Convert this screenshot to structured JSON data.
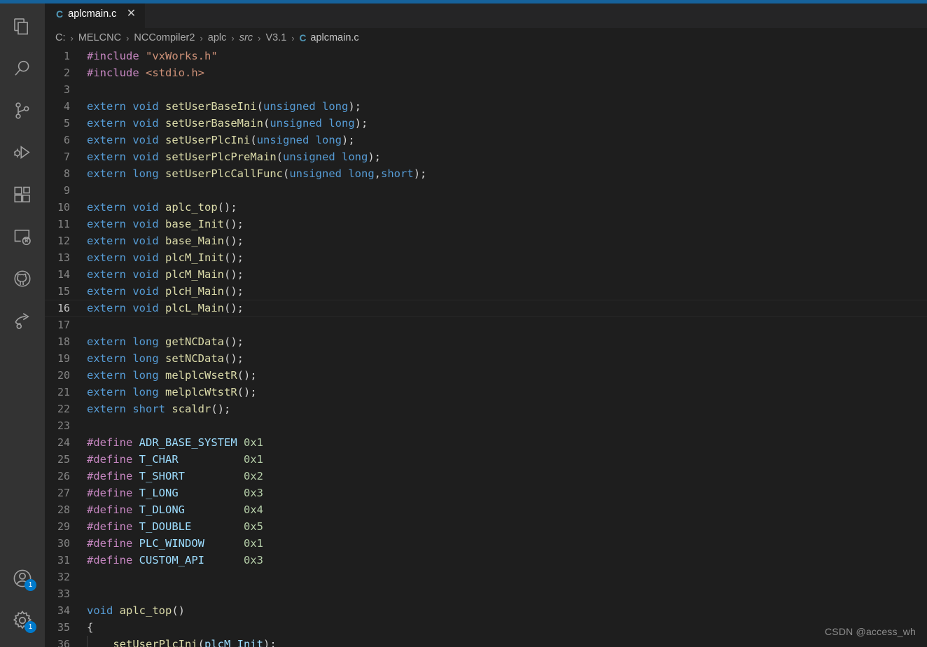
{
  "theme": {
    "accent": "#16629b",
    "activity_bar_bg": "#333333",
    "tab_bar_bg": "#252526",
    "editor_bg": "#1e1e1e",
    "badge_bg": "#007acc"
  },
  "activity_bar": {
    "top_items": [
      {
        "name": "explorer",
        "icon": "files-icon",
        "title": "Explorer"
      },
      {
        "name": "search",
        "icon": "search-icon",
        "title": "Search"
      },
      {
        "name": "source-control",
        "icon": "source-control-icon",
        "title": "Source Control"
      },
      {
        "name": "run-debug",
        "icon": "run-and-debug-icon",
        "title": "Run and Debug"
      },
      {
        "name": "extensions",
        "icon": "extensions-icon",
        "title": "Extensions"
      },
      {
        "name": "remote-explorer",
        "icon": "remote-explorer-icon",
        "title": "Remote Explorer"
      },
      {
        "name": "github",
        "icon": "github-icon",
        "title": "GitHub"
      },
      {
        "name": "live-share",
        "icon": "live-share-icon",
        "title": "Live Share"
      }
    ],
    "bottom_items": [
      {
        "name": "accounts",
        "icon": "account-icon",
        "title": "Accounts",
        "badge": "1"
      },
      {
        "name": "manage",
        "icon": "gear-icon",
        "title": "Manage",
        "badge": "1"
      }
    ]
  },
  "tabs": [
    {
      "label": "aplcmain.c",
      "ext_icon": "C",
      "close_icon": "✕",
      "active": true
    }
  ],
  "breadcrumbs": {
    "separator": "›",
    "items": [
      {
        "label": "C:",
        "italic": false
      },
      {
        "label": "MELCNC",
        "italic": false
      },
      {
        "label": "NCCompiler2",
        "italic": false
      },
      {
        "label": "aplc",
        "italic": false
      },
      {
        "label": "src",
        "italic": true
      },
      {
        "label": "V3.1",
        "italic": false
      }
    ],
    "file_icon": "C",
    "file": "aplcmain.c"
  },
  "editor": {
    "current_line": 16,
    "first_line": 1,
    "lines": [
      {
        "n": 1,
        "tokens": [
          {
            "t": "pre",
            "v": "#include"
          },
          {
            "t": "plain",
            "v": " "
          },
          {
            "t": "str",
            "v": "\"vxWorks.h\""
          }
        ]
      },
      {
        "n": 2,
        "tokens": [
          {
            "t": "pre",
            "v": "#include"
          },
          {
            "t": "plain",
            "v": " "
          },
          {
            "t": "str",
            "v": "<stdio.h>"
          }
        ]
      },
      {
        "n": 3,
        "tokens": []
      },
      {
        "n": 4,
        "tokens": [
          {
            "t": "kw",
            "v": "extern"
          },
          {
            "t": "plain",
            "v": " "
          },
          {
            "t": "kw",
            "v": "void"
          },
          {
            "t": "plain",
            "v": " "
          },
          {
            "t": "fn",
            "v": "setUserBaseIni"
          },
          {
            "t": "punc",
            "v": "("
          },
          {
            "t": "kw",
            "v": "unsigned"
          },
          {
            "t": "plain",
            "v": " "
          },
          {
            "t": "kw",
            "v": "long"
          },
          {
            "t": "punc",
            "v": ");"
          }
        ]
      },
      {
        "n": 5,
        "tokens": [
          {
            "t": "kw",
            "v": "extern"
          },
          {
            "t": "plain",
            "v": " "
          },
          {
            "t": "kw",
            "v": "void"
          },
          {
            "t": "plain",
            "v": " "
          },
          {
            "t": "fn",
            "v": "setUserBaseMain"
          },
          {
            "t": "punc",
            "v": "("
          },
          {
            "t": "kw",
            "v": "unsigned"
          },
          {
            "t": "plain",
            "v": " "
          },
          {
            "t": "kw",
            "v": "long"
          },
          {
            "t": "punc",
            "v": ");"
          }
        ]
      },
      {
        "n": 6,
        "tokens": [
          {
            "t": "kw",
            "v": "extern"
          },
          {
            "t": "plain",
            "v": " "
          },
          {
            "t": "kw",
            "v": "void"
          },
          {
            "t": "plain",
            "v": " "
          },
          {
            "t": "fn",
            "v": "setUserPlcIni"
          },
          {
            "t": "punc",
            "v": "("
          },
          {
            "t": "kw",
            "v": "unsigned"
          },
          {
            "t": "plain",
            "v": " "
          },
          {
            "t": "kw",
            "v": "long"
          },
          {
            "t": "punc",
            "v": ");"
          }
        ]
      },
      {
        "n": 7,
        "tokens": [
          {
            "t": "kw",
            "v": "extern"
          },
          {
            "t": "plain",
            "v": " "
          },
          {
            "t": "kw",
            "v": "void"
          },
          {
            "t": "plain",
            "v": " "
          },
          {
            "t": "fn",
            "v": "setUserPlcPreMain"
          },
          {
            "t": "punc",
            "v": "("
          },
          {
            "t": "kw",
            "v": "unsigned"
          },
          {
            "t": "plain",
            "v": " "
          },
          {
            "t": "kw",
            "v": "long"
          },
          {
            "t": "punc",
            "v": ");"
          }
        ]
      },
      {
        "n": 8,
        "tokens": [
          {
            "t": "kw",
            "v": "extern"
          },
          {
            "t": "plain",
            "v": " "
          },
          {
            "t": "kw",
            "v": "long"
          },
          {
            "t": "plain",
            "v": " "
          },
          {
            "t": "fn",
            "v": "setUserPlcCallFunc"
          },
          {
            "t": "punc",
            "v": "("
          },
          {
            "t": "kw",
            "v": "unsigned"
          },
          {
            "t": "plain",
            "v": " "
          },
          {
            "t": "kw",
            "v": "long"
          },
          {
            "t": "punc",
            "v": ","
          },
          {
            "t": "kw",
            "v": "short"
          },
          {
            "t": "punc",
            "v": ");"
          }
        ]
      },
      {
        "n": 9,
        "tokens": []
      },
      {
        "n": 10,
        "tokens": [
          {
            "t": "kw",
            "v": "extern"
          },
          {
            "t": "plain",
            "v": " "
          },
          {
            "t": "kw",
            "v": "void"
          },
          {
            "t": "plain",
            "v": " "
          },
          {
            "t": "fn",
            "v": "aplc_top"
          },
          {
            "t": "punc",
            "v": "();"
          }
        ]
      },
      {
        "n": 11,
        "tokens": [
          {
            "t": "kw",
            "v": "extern"
          },
          {
            "t": "plain",
            "v": " "
          },
          {
            "t": "kw",
            "v": "void"
          },
          {
            "t": "plain",
            "v": " "
          },
          {
            "t": "fn",
            "v": "base_Init"
          },
          {
            "t": "punc",
            "v": "();"
          }
        ]
      },
      {
        "n": 12,
        "tokens": [
          {
            "t": "kw",
            "v": "extern"
          },
          {
            "t": "plain",
            "v": " "
          },
          {
            "t": "kw",
            "v": "void"
          },
          {
            "t": "plain",
            "v": " "
          },
          {
            "t": "fn",
            "v": "base_Main"
          },
          {
            "t": "punc",
            "v": "();"
          }
        ]
      },
      {
        "n": 13,
        "tokens": [
          {
            "t": "kw",
            "v": "extern"
          },
          {
            "t": "plain",
            "v": " "
          },
          {
            "t": "kw",
            "v": "void"
          },
          {
            "t": "plain",
            "v": " "
          },
          {
            "t": "fn",
            "v": "plcM_Init"
          },
          {
            "t": "punc",
            "v": "();"
          }
        ]
      },
      {
        "n": 14,
        "tokens": [
          {
            "t": "kw",
            "v": "extern"
          },
          {
            "t": "plain",
            "v": " "
          },
          {
            "t": "kw",
            "v": "void"
          },
          {
            "t": "plain",
            "v": " "
          },
          {
            "t": "fn",
            "v": "plcM_Main"
          },
          {
            "t": "punc",
            "v": "();"
          }
        ]
      },
      {
        "n": 15,
        "tokens": [
          {
            "t": "kw",
            "v": "extern"
          },
          {
            "t": "plain",
            "v": " "
          },
          {
            "t": "kw",
            "v": "void"
          },
          {
            "t": "plain",
            "v": " "
          },
          {
            "t": "fn",
            "v": "plcH_Main"
          },
          {
            "t": "punc",
            "v": "();"
          }
        ]
      },
      {
        "n": 16,
        "tokens": [
          {
            "t": "kw",
            "v": "extern"
          },
          {
            "t": "plain",
            "v": " "
          },
          {
            "t": "kw",
            "v": "void"
          },
          {
            "t": "plain",
            "v": " "
          },
          {
            "t": "fn",
            "v": "plcL_Main"
          },
          {
            "t": "punc",
            "v": "();"
          }
        ]
      },
      {
        "n": 17,
        "tokens": []
      },
      {
        "n": 18,
        "tokens": [
          {
            "t": "kw",
            "v": "extern"
          },
          {
            "t": "plain",
            "v": " "
          },
          {
            "t": "kw",
            "v": "long"
          },
          {
            "t": "plain",
            "v": " "
          },
          {
            "t": "fn",
            "v": "getNCData"
          },
          {
            "t": "punc",
            "v": "();"
          }
        ]
      },
      {
        "n": 19,
        "tokens": [
          {
            "t": "kw",
            "v": "extern"
          },
          {
            "t": "plain",
            "v": " "
          },
          {
            "t": "kw",
            "v": "long"
          },
          {
            "t": "plain",
            "v": " "
          },
          {
            "t": "fn",
            "v": "setNCData"
          },
          {
            "t": "punc",
            "v": "();"
          }
        ]
      },
      {
        "n": 20,
        "tokens": [
          {
            "t": "kw",
            "v": "extern"
          },
          {
            "t": "plain",
            "v": " "
          },
          {
            "t": "kw",
            "v": "long"
          },
          {
            "t": "plain",
            "v": " "
          },
          {
            "t": "fn",
            "v": "melplcWsetR"
          },
          {
            "t": "punc",
            "v": "();"
          }
        ]
      },
      {
        "n": 21,
        "tokens": [
          {
            "t": "kw",
            "v": "extern"
          },
          {
            "t": "plain",
            "v": " "
          },
          {
            "t": "kw",
            "v": "long"
          },
          {
            "t": "plain",
            "v": " "
          },
          {
            "t": "fn",
            "v": "melplcWtstR"
          },
          {
            "t": "punc",
            "v": "();"
          }
        ]
      },
      {
        "n": 22,
        "tokens": [
          {
            "t": "kw",
            "v": "extern"
          },
          {
            "t": "plain",
            "v": " "
          },
          {
            "t": "kw",
            "v": "short"
          },
          {
            "t": "plain",
            "v": " "
          },
          {
            "t": "fn",
            "v": "scaldr"
          },
          {
            "t": "punc",
            "v": "();"
          }
        ]
      },
      {
        "n": 23,
        "tokens": []
      },
      {
        "n": 24,
        "tokens": [
          {
            "t": "pre",
            "v": "#define"
          },
          {
            "t": "plain",
            "v": " "
          },
          {
            "t": "var",
            "v": "ADR_BASE_SYSTEM"
          },
          {
            "t": "plain",
            "v": " "
          },
          {
            "t": "num",
            "v": "0x1"
          }
        ]
      },
      {
        "n": 25,
        "tokens": [
          {
            "t": "pre",
            "v": "#define"
          },
          {
            "t": "plain",
            "v": " "
          },
          {
            "t": "var",
            "v": "T_CHAR"
          },
          {
            "t": "plain",
            "v": "          "
          },
          {
            "t": "num",
            "v": "0x1"
          }
        ]
      },
      {
        "n": 26,
        "tokens": [
          {
            "t": "pre",
            "v": "#define"
          },
          {
            "t": "plain",
            "v": " "
          },
          {
            "t": "var",
            "v": "T_SHORT"
          },
          {
            "t": "plain",
            "v": "         "
          },
          {
            "t": "num",
            "v": "0x2"
          }
        ]
      },
      {
        "n": 27,
        "tokens": [
          {
            "t": "pre",
            "v": "#define"
          },
          {
            "t": "plain",
            "v": " "
          },
          {
            "t": "var",
            "v": "T_LONG"
          },
          {
            "t": "plain",
            "v": "          "
          },
          {
            "t": "num",
            "v": "0x3"
          }
        ]
      },
      {
        "n": 28,
        "tokens": [
          {
            "t": "pre",
            "v": "#define"
          },
          {
            "t": "plain",
            "v": " "
          },
          {
            "t": "var",
            "v": "T_DLONG"
          },
          {
            "t": "plain",
            "v": "         "
          },
          {
            "t": "num",
            "v": "0x4"
          }
        ]
      },
      {
        "n": 29,
        "tokens": [
          {
            "t": "pre",
            "v": "#define"
          },
          {
            "t": "plain",
            "v": " "
          },
          {
            "t": "var",
            "v": "T_DOUBLE"
          },
          {
            "t": "plain",
            "v": "        "
          },
          {
            "t": "num",
            "v": "0x5"
          }
        ]
      },
      {
        "n": 30,
        "tokens": [
          {
            "t": "pre",
            "v": "#define"
          },
          {
            "t": "plain",
            "v": " "
          },
          {
            "t": "var",
            "v": "PLC_WINDOW"
          },
          {
            "t": "plain",
            "v": "      "
          },
          {
            "t": "num",
            "v": "0x1"
          }
        ]
      },
      {
        "n": 31,
        "tokens": [
          {
            "t": "pre",
            "v": "#define"
          },
          {
            "t": "plain",
            "v": " "
          },
          {
            "t": "var",
            "v": "CUSTOM_API"
          },
          {
            "t": "plain",
            "v": "      "
          },
          {
            "t": "num",
            "v": "0x3"
          }
        ]
      },
      {
        "n": 32,
        "tokens": []
      },
      {
        "n": 33,
        "tokens": []
      },
      {
        "n": 34,
        "tokens": [
          {
            "t": "kw",
            "v": "void"
          },
          {
            "t": "plain",
            "v": " "
          },
          {
            "t": "fn",
            "v": "aplc_top"
          },
          {
            "t": "punc",
            "v": "()"
          }
        ]
      },
      {
        "n": 35,
        "tokens": [
          {
            "t": "punc",
            "v": "{"
          }
        ]
      },
      {
        "n": 36,
        "tokens": [
          {
            "t": "plain",
            "v": "    "
          },
          {
            "t": "fn",
            "v": "setUserPlcIni"
          },
          {
            "t": "punc",
            "v": "("
          },
          {
            "t": "var",
            "v": "plcM_Init"
          },
          {
            "t": "punc",
            "v": ");"
          }
        ],
        "indent_guides": [
          0
        ]
      }
    ]
  },
  "watermark": {
    "text": "CSDN @access_wh"
  }
}
